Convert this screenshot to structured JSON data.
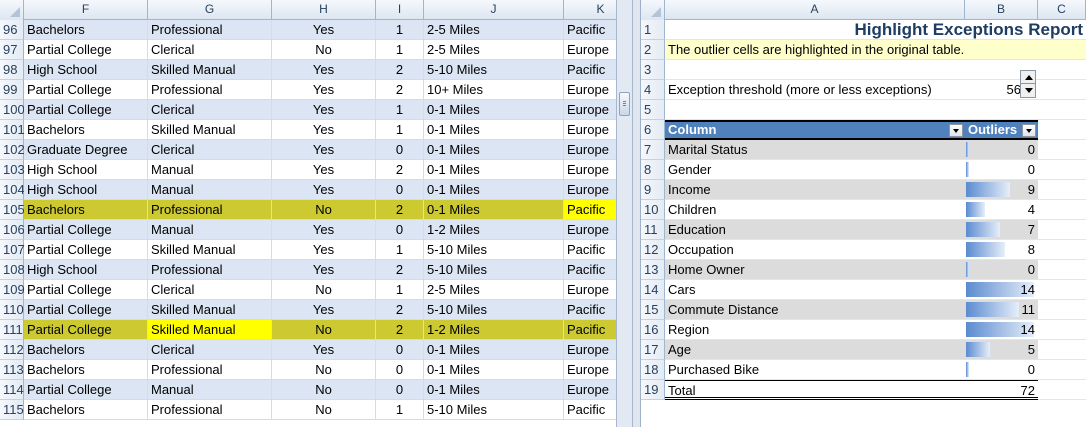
{
  "left": {
    "columns": [
      "F",
      "G",
      "H",
      "I",
      "J",
      "K"
    ],
    "rows": [
      {
        "num": "96",
        "f": "Bachelors",
        "g": "Professional",
        "h": "Yes",
        "i": "1",
        "j": "2-5 Miles",
        "k": "Pacific"
      },
      {
        "num": "97",
        "f": "Partial College",
        "g": "Clerical",
        "h": "No",
        "i": "1",
        "j": "2-5 Miles",
        "k": "Europe"
      },
      {
        "num": "98",
        "f": "High School",
        "g": "Skilled Manual",
        "h": "Yes",
        "i": "2",
        "j": "5-10 Miles",
        "k": "Pacific"
      },
      {
        "num": "99",
        "f": "Partial College",
        "g": "Professional",
        "h": "Yes",
        "i": "2",
        "j": "10+ Miles",
        "k": "Europe"
      },
      {
        "num": "100",
        "f": "Partial College",
        "g": "Clerical",
        "h": "Yes",
        "i": "1",
        "j": "0-1 Miles",
        "k": "Europe"
      },
      {
        "num": "101",
        "f": "Bachelors",
        "g": "Skilled Manual",
        "h": "Yes",
        "i": "1",
        "j": "0-1 Miles",
        "k": "Europe"
      },
      {
        "num": "102",
        "f": "Graduate Degree",
        "g": "Clerical",
        "h": "Yes",
        "i": "0",
        "j": "0-1 Miles",
        "k": "Europe"
      },
      {
        "num": "103",
        "f": "High School",
        "g": "Manual",
        "h": "Yes",
        "i": "2",
        "j": "0-1 Miles",
        "k": "Europe"
      },
      {
        "num": "104",
        "f": "High School",
        "g": "Manual",
        "h": "Yes",
        "i": "0",
        "j": "0-1 Miles",
        "k": "Europe"
      },
      {
        "num": "105",
        "f": "Bachelors",
        "g": "Professional",
        "h": "No",
        "i": "2",
        "j": "0-1 Miles",
        "k": "Pacific"
      },
      {
        "num": "106",
        "f": "Partial College",
        "g": "Manual",
        "h": "Yes",
        "i": "0",
        "j": "1-2 Miles",
        "k": "Europe"
      },
      {
        "num": "107",
        "f": "Partial College",
        "g": "Skilled Manual",
        "h": "Yes",
        "i": "1",
        "j": "5-10 Miles",
        "k": "Pacific"
      },
      {
        "num": "108",
        "f": "High School",
        "g": "Professional",
        "h": "Yes",
        "i": "2",
        "j": "5-10 Miles",
        "k": "Pacific"
      },
      {
        "num": "109",
        "f": "Partial College",
        "g": "Clerical",
        "h": "No",
        "i": "1",
        "j": "2-5 Miles",
        "k": "Europe"
      },
      {
        "num": "110",
        "f": "Partial College",
        "g": "Skilled Manual",
        "h": "Yes",
        "i": "2",
        "j": "5-10 Miles",
        "k": "Pacific"
      },
      {
        "num": "111",
        "f": "Partial College",
        "g": "Skilled Manual",
        "h": "No",
        "i": "2",
        "j": "1-2 Miles",
        "k": "Pacific"
      },
      {
        "num": "112",
        "f": "Bachelors",
        "g": "Clerical",
        "h": "Yes",
        "i": "0",
        "j": "0-1 Miles",
        "k": "Europe"
      },
      {
        "num": "113",
        "f": "Bachelors",
        "g": "Professional",
        "h": "No",
        "i": "0",
        "j": "0-1 Miles",
        "k": "Europe"
      },
      {
        "num": "114",
        "f": "Partial College",
        "g": "Manual",
        "h": "No",
        "i": "0",
        "j": "0-1 Miles",
        "k": "Europe"
      },
      {
        "num": "115",
        "f": "Bachelors",
        "g": "Professional",
        "h": "No",
        "i": "1",
        "j": "5-10 Miles",
        "k": "Pacific"
      }
    ]
  },
  "right": {
    "columns": [
      "A",
      "B",
      "C"
    ],
    "title": "Highlight Exceptions Report",
    "note": "The outlier cells are highlighted in the original table.",
    "threshold_label": "Exception threshold (more or less exceptions)",
    "threshold_value": "56",
    "header_column": "Column",
    "header_outliers": "Outliers",
    "items": [
      {
        "name": "Marital Status",
        "value": 0
      },
      {
        "name": "Gender",
        "value": 0
      },
      {
        "name": "Income",
        "value": 9
      },
      {
        "name": "Children",
        "value": 4
      },
      {
        "name": "Education",
        "value": 7
      },
      {
        "name": "Occupation",
        "value": 8
      },
      {
        "name": "Home Owner",
        "value": 0
      },
      {
        "name": "Cars",
        "value": 14
      },
      {
        "name": "Commute Distance",
        "value": 11
      },
      {
        "name": "Region",
        "value": 14
      },
      {
        "name": "Age",
        "value": 5
      },
      {
        "name": "Purchased Bike",
        "value": 0
      }
    ],
    "total_label": "Total",
    "total_value": "72",
    "row_numbers": [
      "1",
      "2",
      "3",
      "4",
      "5",
      "6",
      "7",
      "8",
      "9",
      "10",
      "11",
      "12",
      "13",
      "14",
      "15",
      "16",
      "17",
      "18",
      "19"
    ]
  }
}
